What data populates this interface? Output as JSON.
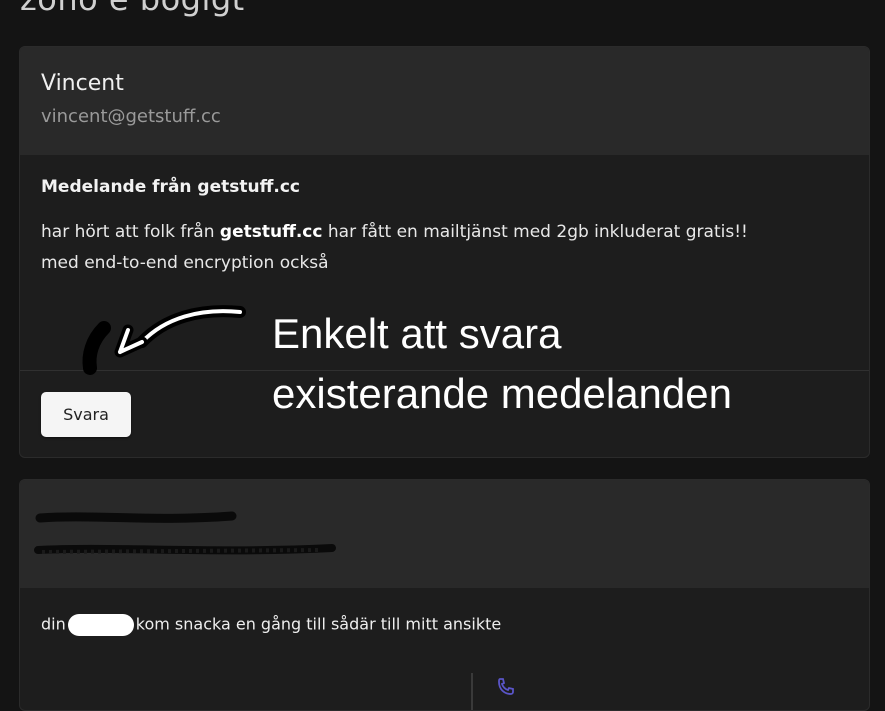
{
  "page": {
    "title": "zono e bögigt"
  },
  "message_card": {
    "sender_name": "Vincent",
    "sender_email": "vincent@getstuff.cc",
    "subject": "Medelande från getstuff.cc",
    "body_part1": "har hört att folk från ",
    "body_bold": "getstuff.cc",
    "body_part2": " har fått en mailtjänst med 2gb inkluderat gratis!!",
    "body_line2": "med end-to-end encryption också",
    "reply_label": "Svara"
  },
  "annotation": {
    "line1": "Enkelt att svara",
    "line2": "existerande medelanden"
  },
  "second_card": {
    "body_prefix": "din",
    "body_text": "kom snacka en gång till sådär till mitt ansikte"
  },
  "colors": {
    "background": "#141414",
    "card": "#1d1d1d",
    "card_header": "#292929",
    "reply_button": "#f5f5f5",
    "annotation_text": "#ffffff"
  },
  "icons": [
    "arrow-annotation-icon",
    "phone-icon",
    "redaction-scribble"
  ]
}
